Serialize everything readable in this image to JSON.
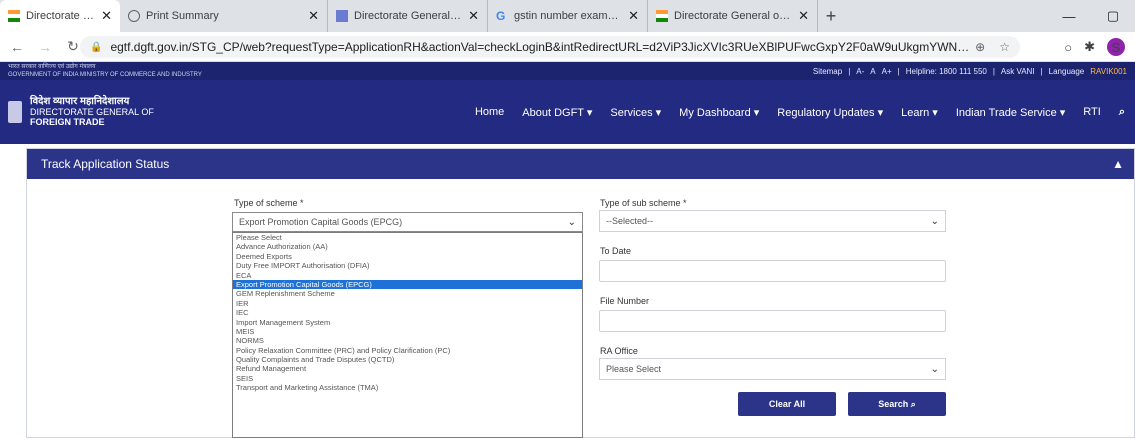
{
  "browser": {
    "tabs": [
      {
        "title": "Directorate General of Foreign",
        "active": true,
        "favicon": "dgft-flag"
      },
      {
        "title": "Print Summary",
        "active": false,
        "favicon": "globe"
      },
      {
        "title": "Directorate General of Foreign",
        "active": false,
        "favicon": "dgft-flag"
      },
      {
        "title": "gstin number example - Googl",
        "active": false,
        "favicon": "google"
      },
      {
        "title": "Directorate General of Foreign",
        "active": false,
        "favicon": "dgft-flag"
      }
    ],
    "url": "egtf.dgft.gov.in/STG_CP/web?requestType=ApplicationRH&actionVal=checkLoginB&intRedirectURL=d2ViP3JicXVIc3RUeXBlPUFwcGxpY2F0aW9uUkgmYWN0aW9u...",
    "profile_initial": "S"
  },
  "topstrip": {
    "left_line1": "भारत सरकार  वाणिज्य एवं उद्योग मंत्रालय",
    "left_line2": "GOVERNMENT OF INDIA   MINISTRY OF COMMERCE AND INDUSTRY",
    "sitemap": "Sitemap",
    "font_a_minus": "A-",
    "font_a": "A",
    "font_a_plus": "A+",
    "helpline": "Helpline: 1800 111 550",
    "ask": "Ask VANI",
    "language": "Language",
    "user": "RAVIK001"
  },
  "brand": {
    "hindi": "विदेश व्यापार महानिदेशालय",
    "line1": "DIRECTORATE GENERAL OF",
    "line2": "FOREIGN TRADE"
  },
  "menu": [
    "Home",
    "About DGFT",
    "Services",
    "My Dashboard",
    "Regulatory Updates",
    "Learn",
    "Indian Trade Service",
    "RTI"
  ],
  "panel": {
    "title": "Track Application Status",
    "scheme_label": "Type of scheme *",
    "scheme_value": "Export Promotion Capital Goods (EPCG)",
    "sub_scheme_label": "Type of sub scheme *",
    "sub_scheme_value": "--Selected--",
    "to_date_label": "To Date",
    "file_number_label": "File Number",
    "ra_office_label": "RA Office",
    "ra_office_value": "Please Select",
    "clear_label": "Clear All",
    "search_label": "Search"
  },
  "dropdown_options": [
    "Please Select",
    "Advance Authorization (AA)",
    "Deemed Exports",
    "Duty Free IMPORT Authorisation (DFIA)",
    "ECA",
    "Export Promotion Capital Goods (EPCG)",
    "GEM Replenishment Scheme",
    "IER",
    "IEC",
    "Import Management System",
    "MEIS",
    "NORMS",
    "Policy Relaxation Committee (PRC) and Policy Clarification (PC)",
    "Quality Complaints and Trade Disputes (QCTD)",
    "Refund Management",
    "SEIS",
    "Transport and Marketing Assistance (TMA)"
  ],
  "selected_option_index": 5
}
